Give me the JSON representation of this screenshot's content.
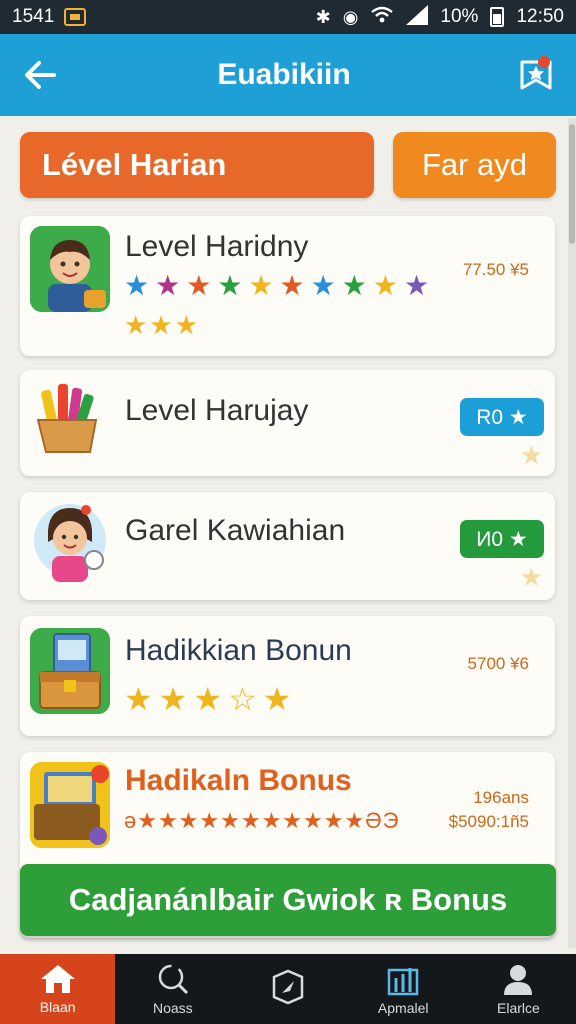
{
  "status_bar": {
    "time_left": "1541",
    "battery": "10%",
    "clock": "12:50"
  },
  "app_bar": {
    "title": "Euabikiin"
  },
  "tabs": [
    {
      "label": "Lével Harian"
    },
    {
      "label": "Far ayd"
    }
  ],
  "cards": [
    {
      "title": "Level Haridny",
      "value": "77.50 ¥5",
      "stars_row1": [
        "#2a8fd8",
        "#b0348c",
        "#e15a23",
        "#2aa040",
        "#f0b41e",
        "#e15a23",
        "#2a8fd8",
        "#2aa040",
        "#f0b41e",
        "#7b58b8"
      ],
      "stars_row2_count": 3
    },
    {
      "title": "Level Harujay",
      "badge": "R0 ★"
    },
    {
      "title": "Garel Kawiahian",
      "badge": "И0 ★"
    },
    {
      "title": "Hadikkian Bonun",
      "value": "5700 ¥6",
      "stars": "★★★☆★"
    },
    {
      "title": "Hadikaln Bonus",
      "value_top": "196ans",
      "value_bottom": "$5090:1ñ5",
      "symbols": "ə★★★★★★★★★★★ƏЭ"
    }
  ],
  "bonus_button": {
    "label": "Cadjanánlbair Gwiok ʀ Bonus"
  },
  "bottom_nav": [
    {
      "label": "Blaan",
      "icon": "home-icon"
    },
    {
      "label": "Noass",
      "icon": "search-icon"
    },
    {
      "label": "",
      "icon": "compass-icon"
    },
    {
      "label": "Apmalel",
      "icon": "chart-icon"
    },
    {
      "label": "Elarlce",
      "icon": "profile-icon"
    }
  ],
  "colors": {
    "app_bar": "#1e9fd6",
    "tab_primary": "#e8682a",
    "tab_secondary": "#f08a1f",
    "bonus_button": "#2e9e38",
    "nav_active": "#d6441c"
  }
}
